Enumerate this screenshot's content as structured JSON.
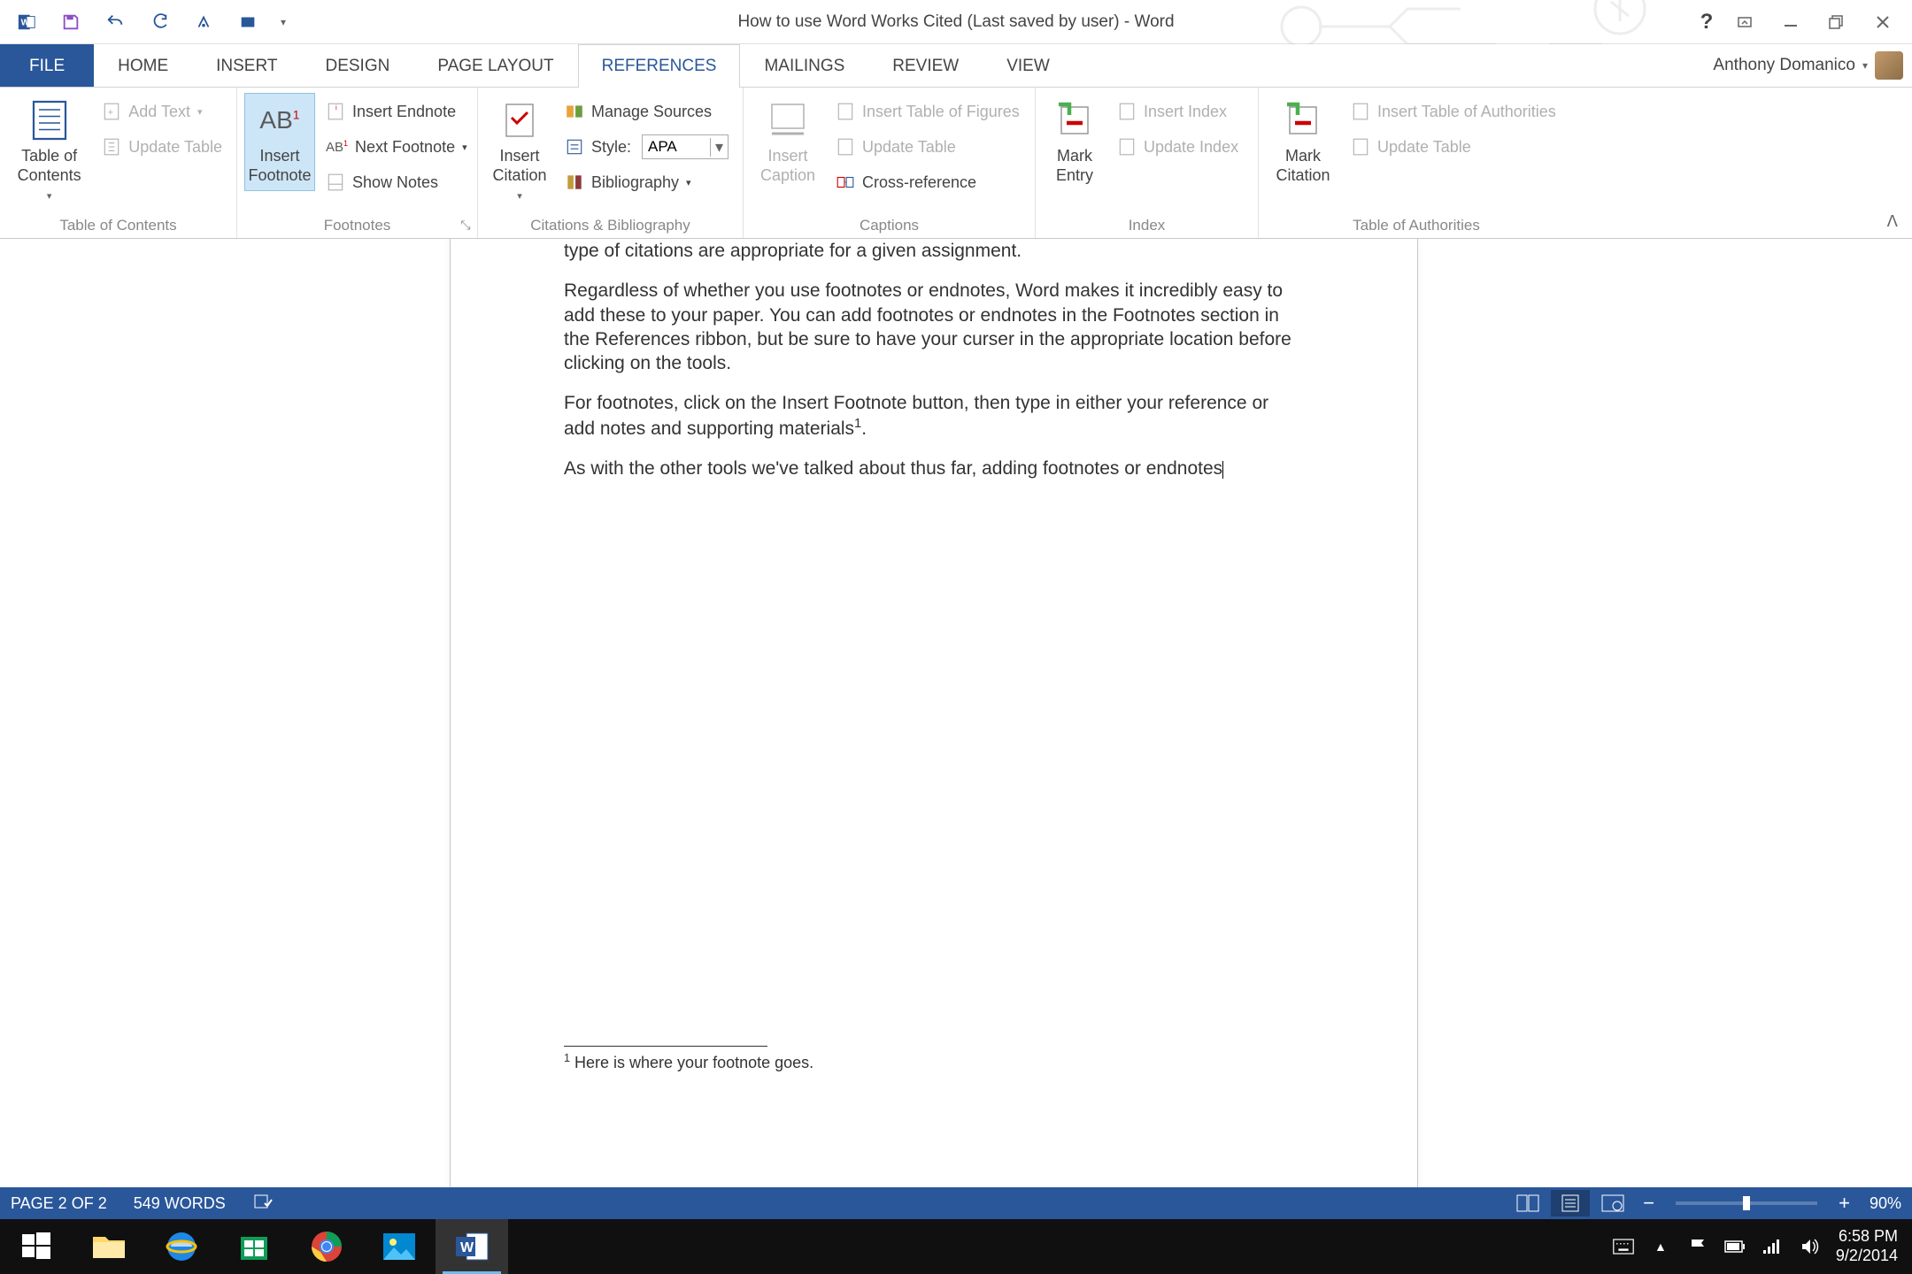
{
  "title": "How to use Word Works Cited (Last saved by user) - Word",
  "user": "Anthony Domanico",
  "tabs": {
    "file": "FILE",
    "home": "HOME",
    "insert": "INSERT",
    "design": "DESIGN",
    "page_layout": "PAGE LAYOUT",
    "references": "REFERENCES",
    "mailings": "MAILINGS",
    "review": "REVIEW",
    "view": "VIEW"
  },
  "ribbon": {
    "toc": {
      "big": "Table of\nContents",
      "add_text": "Add Text",
      "update": "Update Table",
      "group": "Table of Contents"
    },
    "footnotes": {
      "big": "Insert\nFootnote",
      "endnote": "Insert Endnote",
      "next": "Next Footnote",
      "show": "Show Notes",
      "group": "Footnotes"
    },
    "citations": {
      "big": "Insert\nCitation",
      "manage": "Manage Sources",
      "style_label": "Style:",
      "style_value": "APA",
      "biblio": "Bibliography",
      "group": "Citations & Bibliography"
    },
    "captions": {
      "big": "Insert\nCaption",
      "figures": "Insert Table of Figures",
      "update": "Update Table",
      "cross": "Cross-reference",
      "group": "Captions"
    },
    "index": {
      "big": "Mark\nEntry",
      "insert": "Insert Index",
      "update": "Update Index",
      "group": "Index"
    },
    "authorities": {
      "big": "Mark\nCitation",
      "insert": "Insert Table of Authorities",
      "update": "Update Table",
      "group": "Table of Authorities"
    }
  },
  "document": {
    "p0": "type of citations are appropriate for a given assignment.",
    "p1": "Regardless of whether you use footnotes or endnotes, Word makes it incredibly easy to add these to your paper. You can add footnotes or endnotes in the Footnotes section in the References ribbon, but be sure to have your curser in the appropriate location before clicking on the tools.",
    "p2a": "For footnotes, click on the Insert Footnote button, then type in either your reference or add notes and supporting materials",
    "p2b": ".",
    "p3": "As with the other tools we've talked about thus far, adding footnotes or endnotes",
    "footnote_num": "1",
    "footnote_text": " Here is where your footnote goes."
  },
  "status": {
    "page": "PAGE 2 OF 2",
    "words": "549 WORDS",
    "zoom": "90%"
  },
  "clock": {
    "time": "6:58 PM",
    "date": "9/2/2014"
  }
}
